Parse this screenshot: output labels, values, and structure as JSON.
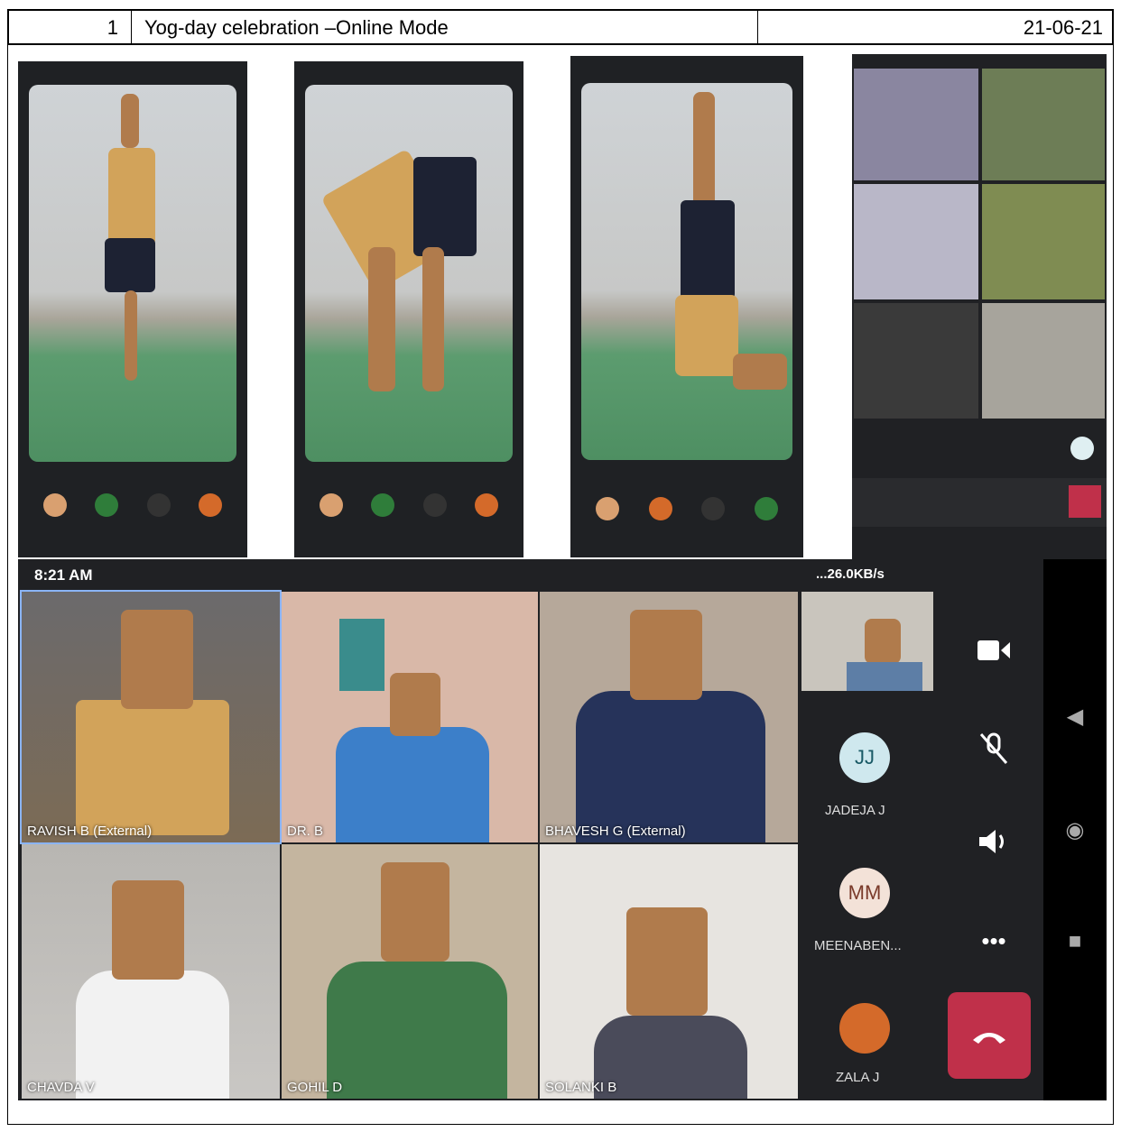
{
  "header": {
    "number": "1",
    "title": "Yog-day celebration –Online Mode",
    "date": "21-06-21"
  },
  "meet": {
    "status_time": "8:21 AM",
    "status_right": "...26.0KB/s",
    "participants": [
      {
        "name": "RAVISH B (External)"
      },
      {
        "name": "DR. B"
      },
      {
        "name": "BHAVESH G (External)"
      },
      {
        "name": "CHAVDA V"
      },
      {
        "name": "GOHIL D"
      },
      {
        "name": "SOLANKI B"
      }
    ],
    "side_participants": [
      {
        "initials": "JJ",
        "name": "JADEJA J"
      },
      {
        "initials": "MM",
        "name": "MEENABEN..."
      },
      {
        "initials": "",
        "name": "ZALA J"
      }
    ],
    "controls": [
      "camera-icon",
      "mic-off-icon",
      "speaker-icon",
      "more-icon",
      "end-call-icon"
    ]
  },
  "colors": {
    "meet_bg": "#202124",
    "end_call": "#c0304a",
    "avatar_jj": "#cfe8ee",
    "avatar_mm": "#f3e2d8"
  }
}
